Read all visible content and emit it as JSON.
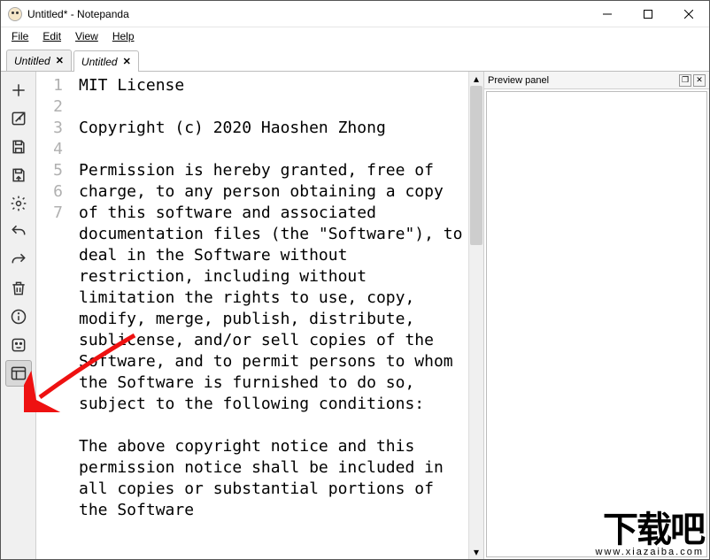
{
  "window": {
    "title": "Untitled* - Notepanda"
  },
  "menu": {
    "file": "File",
    "edit": "Edit",
    "view": "View",
    "help": "Help"
  },
  "tabs": [
    {
      "label": "Untitled",
      "active": false
    },
    {
      "label": "Untitled",
      "active": true
    }
  ],
  "toolbar_icons": [
    "new",
    "open",
    "save",
    "save-as",
    "settings",
    "undo",
    "redo",
    "delete",
    "info",
    "sticker",
    "preview"
  ],
  "editor": {
    "lines": [
      {
        "n": 1,
        "text": "MIT License"
      },
      {
        "n": 2,
        "text": ""
      },
      {
        "n": 3,
        "text": "Copyright (c) 2020 Haoshen Zhong"
      },
      {
        "n": 4,
        "text": ""
      },
      {
        "n": 5,
        "text": "Permission is hereby granted, free of charge, to any person obtaining a copy of this software and associated documentation files (the \"Software\"), to deal in the Software without restriction, including without limitation the rights to use, copy, modify, merge, publish, distribute, sublicense, and/or sell copies of the Software, and to permit persons to whom the Software is furnished to do so, subject to the following conditions:"
      },
      {
        "n": 6,
        "text": ""
      },
      {
        "n": 7,
        "text": "The above copyright notice and this permission notice shall be included in all copies or substantial portions of the Software"
      }
    ]
  },
  "preview": {
    "title": "Preview panel"
  },
  "watermark": {
    "big": "下载吧",
    "small": "www.xiazaiba.com"
  }
}
